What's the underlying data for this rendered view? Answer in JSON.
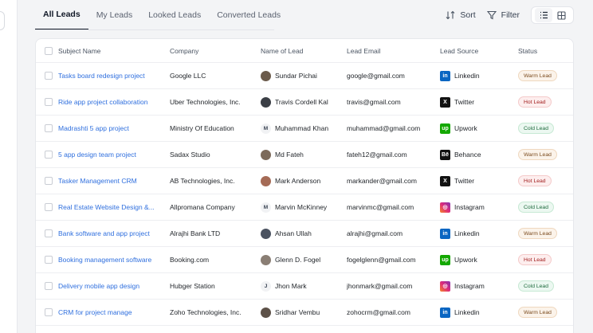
{
  "tabs": [
    {
      "label": "All Leads",
      "active": true
    },
    {
      "label": "My Leads",
      "active": false
    },
    {
      "label": "Looked Leads",
      "active": false
    },
    {
      "label": "Converted Leads",
      "active": false
    }
  ],
  "actions": {
    "sort_label": "Sort",
    "filter_label": "Filter"
  },
  "table": {
    "headers": {
      "subject": "Subject Name",
      "company": "Company",
      "name": "Name of Lead",
      "email": "Lead Email",
      "source": "Lead Source",
      "status": "Status"
    },
    "rows": [
      {
        "subject": "Tasks board redesign project",
        "company": "Google LLC",
        "name": "Sundar Pichai",
        "avatar": "photo",
        "avatar_color": "#6b5b4b",
        "email": "google@gmail.com",
        "source": "Linkedin",
        "source_icon": "linkedin-icon",
        "status": "Warm Lead",
        "status_type": "warm"
      },
      {
        "subject": "Ride app project collaboration",
        "company": "Uber Technologies, Inc.",
        "name": "Travis Cordell Kal",
        "avatar": "photo",
        "avatar_color": "#3b3f46",
        "email": "travis@gmail.com",
        "source": "Twitter",
        "source_icon": "x-twitter-icon",
        "status": "Hot Lead",
        "status_type": "hot"
      },
      {
        "subject": "Madrashti 5 app project",
        "company": "Ministry Of Education",
        "name": "Muhammad Khan",
        "avatar": "initial",
        "initial": "M",
        "email": "muhammad@gmail.com",
        "source": "Upwork",
        "source_icon": "upwork-icon",
        "status": "Cold Lead",
        "status_type": "cold"
      },
      {
        "subject": "5 app design team project",
        "company": "Sadax Studio",
        "name": "Md Fateh",
        "avatar": "photo",
        "avatar_color": "#7c6a5a",
        "email": "fateh12@gmail.com",
        "source": "Behance",
        "source_icon": "behance-icon",
        "status": "Warm Lead",
        "status_type": "warm"
      },
      {
        "subject": "Tasker Management CRM",
        "company": "AB Technologies, Inc.",
        "name": "Mark Anderson",
        "avatar": "photo",
        "avatar_color": "#a56b56",
        "email": "markander@gmail.com",
        "source": "Twitter",
        "source_icon": "x-twitter-icon",
        "status": "Hot Lead",
        "status_type": "hot"
      },
      {
        "subject": "Real Estate Website Design &...",
        "company": "Allpromana Company",
        "name": "Marvin McKinney",
        "avatar": "initial",
        "initial": "M",
        "email": "marvinmc@gmail.com",
        "source": "Instagram",
        "source_icon": "instagram-icon",
        "status": "Cold Lead",
        "status_type": "cold"
      },
      {
        "subject": "Bank software and app project",
        "company": "Alrajhi Bank LTD",
        "name": "Ahsan Ullah",
        "avatar": "photo",
        "avatar_color": "#4a5260",
        "email": "alrajhi@gmail.com",
        "source": "Linkedin",
        "source_icon": "linkedin-icon",
        "status": "Warm Lead",
        "status_type": "warm"
      },
      {
        "subject": "Booking management software",
        "company": "Booking.com",
        "name": "Glenn D. Fogel",
        "avatar": "photo",
        "avatar_color": "#8a7e74",
        "email": "fogelglenn@gmail.com",
        "source": "Upwork",
        "source_icon": "upwork-icon",
        "status": "Hot Lead",
        "status_type": "hot"
      },
      {
        "subject": "Delivery mobile app design",
        "company": "Hubger Station",
        "name": "Jhon Mark",
        "avatar": "initial",
        "initial": "J",
        "email": "jhonmark@gmail.com",
        "source": "Instagram",
        "source_icon": "instagram-icon",
        "status": "Cold Lead",
        "status_type": "cold"
      },
      {
        "subject": "CRM for project manage",
        "company": "Zoho Technologies, Inc.",
        "name": "Sridhar Vembu",
        "avatar": "photo",
        "avatar_color": "#5d5148",
        "email": "zohocrm@gmail.com",
        "source": "Linkedin",
        "source_icon": "linkedin-icon",
        "status": "Warm Lead",
        "status_type": "warm"
      }
    ]
  }
}
